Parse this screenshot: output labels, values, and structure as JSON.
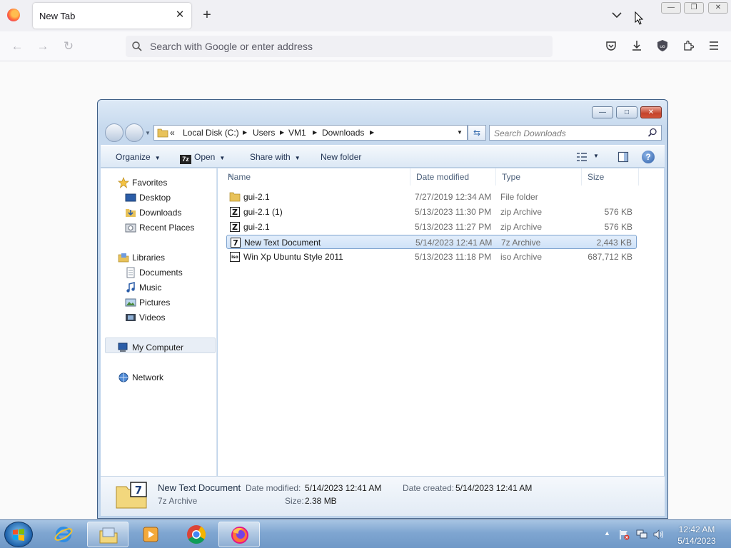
{
  "browser": {
    "tab_title": "New Tab",
    "tab_close": "✕",
    "new_tab": "+",
    "url_placeholder": "Search with Google or enter address",
    "min_label": "—",
    "max_label": "❐",
    "close_label": "✕"
  },
  "explorer": {
    "title_buttons": {
      "minimize": "—",
      "maximize": "□",
      "close": "✕"
    },
    "breadcrumb": {
      "prefix": "«",
      "items": [
        "Local Disk (C:)",
        "Users",
        "VM1",
        "Downloads"
      ]
    },
    "search_placeholder": "Search Downloads",
    "toolbar": {
      "organize": "Organize",
      "open": "Open",
      "open_icon_text": "7z",
      "share_with": "Share with",
      "new_folder": "New folder",
      "help": "?"
    },
    "nav": {
      "favorites": "Favorites",
      "desktop": "Desktop",
      "downloads": "Downloads",
      "recent_places": "Recent Places",
      "libraries": "Libraries",
      "documents": "Documents",
      "music": "Music",
      "pictures": "Pictures",
      "videos": "Videos",
      "my_computer": "My Computer",
      "network": "Network"
    },
    "columns": {
      "name": "Name",
      "date": "Date modified",
      "type": "Type",
      "size": "Size"
    },
    "files": [
      {
        "name": "gui-2.1",
        "date": "7/27/2019 12:34 AM",
        "type": "File folder",
        "size": "",
        "icon": "folder-icon"
      },
      {
        "name": "gui-2.1 (1)",
        "date": "5/13/2023 11:30 PM",
        "type": "zip Archive",
        "size": "576 KB",
        "icon": "zip-archive-icon"
      },
      {
        "name": "gui-2.1",
        "date": "5/13/2023 11:27 PM",
        "type": "zip Archive",
        "size": "576 KB",
        "icon": "zip-archive-icon"
      },
      {
        "name": "New Text Document",
        "date": "5/14/2023 12:41 AM",
        "type": "7z Archive",
        "size": "2,443 KB",
        "icon": "7z-archive-icon"
      },
      {
        "name": "Win Xp Ubuntu Style 2011",
        "date": "5/13/2023 11:18 PM",
        "type": "iso Archive",
        "size": "687,712 KB",
        "icon": "iso-archive-icon"
      }
    ],
    "details": {
      "name": "New Text Document",
      "type": "7z Archive",
      "date_modified_label": "Date modified:",
      "date_modified": "5/14/2023 12:41 AM",
      "date_created_label": "Date created:",
      "date_created": "5/14/2023 12:41 AM",
      "size_label": "Size:",
      "size": "2.38 MB",
      "icon_text": "7"
    }
  },
  "taskbar": {
    "time": "12:42 AM",
    "date": "5/14/2023",
    "tray_arrow": "▲"
  },
  "colors": {
    "selection": "#cfe2f8",
    "taskbar": "#7fa6d1",
    "firefox_accent": "#ff7139"
  }
}
